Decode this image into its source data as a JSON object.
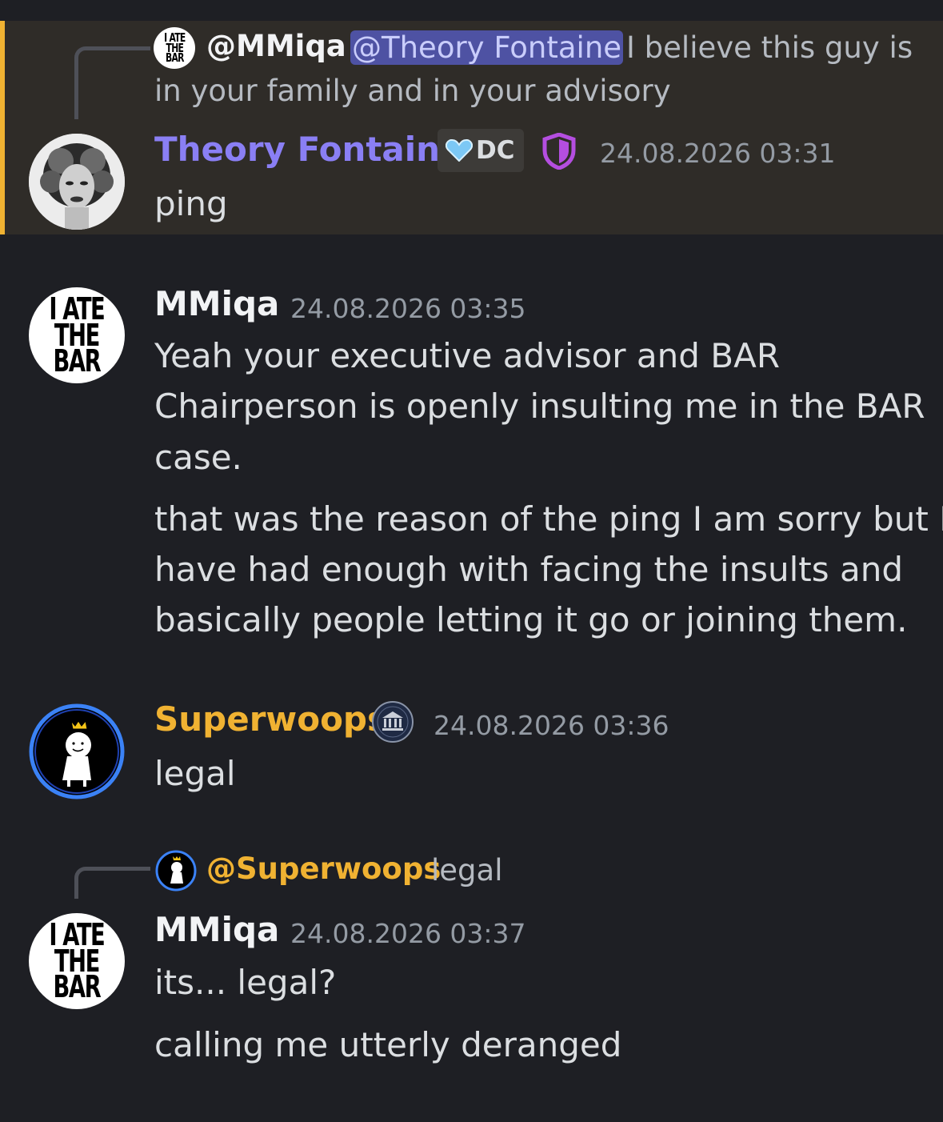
{
  "messages": [
    {
      "reply": {
        "author": "@MMiqa",
        "mention": "@Theory Fontaine",
        "text_line1": "I believe this guy is",
        "text_line2": "in your family and in your advisory"
      },
      "author": "Theory Fontaine",
      "author_color": "#8a7ff4",
      "tag": "DC",
      "timestamp": "24.08.2026 03:31",
      "lines": [
        "ping"
      ],
      "highlighted": true
    },
    {
      "author": "MMiqa",
      "author_color": "#f2f3f5",
      "timestamp": "24.08.2026 03:35",
      "lines": [
        "Yeah your executive advisor and BAR",
        "Chairperson is openly insulting me in the BAR",
        "case."
      ],
      "lines2": [
        "that was the reason of the ping I am sorry but I",
        "have had enough with facing the insults and",
        "basically people letting it go or joining them."
      ]
    },
    {
      "author": "Superwoops",
      "author_color": "#f0b232",
      "timestamp": "24.08.2026 03:36",
      "lines": [
        "legal"
      ]
    },
    {
      "reply": {
        "author": "@Superwoops",
        "text": "legal"
      },
      "author": "MMiqa",
      "author_color": "#f2f3f5",
      "timestamp": "24.08.2026 03:37",
      "lines": [
        "its... legal?"
      ],
      "lines2": [
        "calling me utterly deranged"
      ]
    }
  ],
  "logo": {
    "line1": "I ATE",
    "line2": "THE",
    "line3": "BAR"
  },
  "icons": {
    "tag_icon": "heart-icon",
    "role_icon": "shield-icon",
    "server_icon": "courthouse-icon"
  }
}
